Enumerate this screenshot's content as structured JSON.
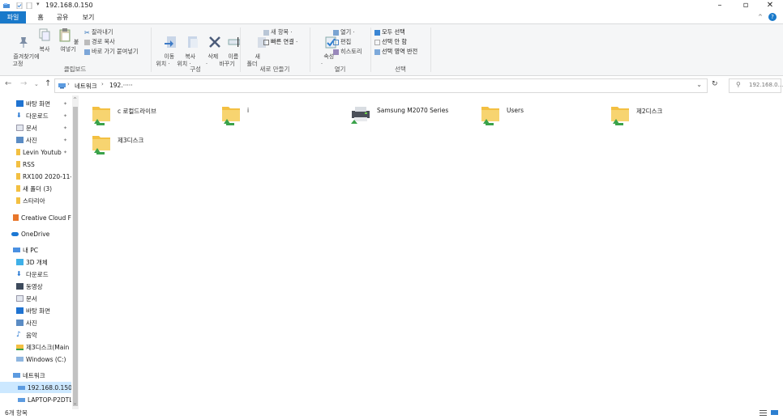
{
  "titlebar": {
    "title": "192.168.0.150"
  },
  "tabs": [
    {
      "label": "파일"
    },
    {
      "label": "홈"
    },
    {
      "label": "공유"
    },
    {
      "label": "보기"
    }
  ],
  "ribbon": {
    "clipboard": {
      "pin_label": "즐겨찾기에\n고정",
      "copy_label": "복사",
      "paste_label": "붙여넣기",
      "cut_label": "잘라내기",
      "copy_path_label": "경로 복사",
      "paste_shortcut_label": "바로 가기 붙여넣기",
      "group_label": "클립보드"
    },
    "organize": {
      "move_label": "이동\n위치 ·",
      "copy_to_label": "복사\n위치 ·",
      "delete_label": "삭제\n·",
      "rename_label": "이름\n바꾸기",
      "group_label": "구성"
    },
    "new": {
      "new_folder_label": "새\n폴더",
      "new_item_label": "새 항목 ·",
      "easy_access_label": "빠른 연결 ·",
      "group_label": "새로 만들기"
    },
    "open": {
      "properties_label": "속성\n·",
      "open_label": "열기 ·",
      "edit_label": "편집",
      "history_label": "히스토리",
      "group_label": "열기"
    },
    "select": {
      "select_all_label": "모두 선택",
      "select_none_label": "선택 안 함",
      "invert_label": "선택 영역 반전",
      "group_label": "선택"
    }
  },
  "address": {
    "path_part1": "네트워크",
    "path_part2": "192.·····",
    "search_placeholder": "192.168.0..."
  },
  "sidebar": {
    "items": [
      {
        "label": "바탕 화면"
      },
      {
        "label": "다운로드"
      },
      {
        "label": "문서"
      },
      {
        "label": "사진"
      },
      {
        "label": "Levin Youtub"
      },
      {
        "label": "RSS"
      },
      {
        "label": "RX100 2020-11-"
      },
      {
        "label": "새 폴더 (3)"
      },
      {
        "label": "스타리아"
      },
      {
        "label": "Creative Cloud Fil"
      },
      {
        "label": "OneDrive"
      },
      {
        "label": "내 PC"
      },
      {
        "label": "3D 개체"
      },
      {
        "label": "다운로드"
      },
      {
        "label": "동영상"
      },
      {
        "label": "문서"
      },
      {
        "label": "바탕 화면"
      },
      {
        "label": "사진"
      },
      {
        "label": "음악"
      },
      {
        "label": "제3디스크(Main"
      },
      {
        "label": "Windows (C:)"
      },
      {
        "label": "네트워크"
      },
      {
        "label": "192.168.0.150"
      },
      {
        "label": "LAPTOP-P2DTLK"
      }
    ]
  },
  "content": {
    "items": [
      {
        "label": "c 로컬드라이브"
      },
      {
        "label": "i"
      },
      {
        "label": "Samsung M2070 Series"
      },
      {
        "label": "Users"
      },
      {
        "label": "제2디스크"
      },
      {
        "label": "제3디스크"
      }
    ]
  },
  "status": {
    "item_count": "6개 항목"
  },
  "colors": {
    "accent": "#1979ca",
    "folder": "#f3c042",
    "share": "#3aa24a",
    "selected": "#cce8ff"
  }
}
